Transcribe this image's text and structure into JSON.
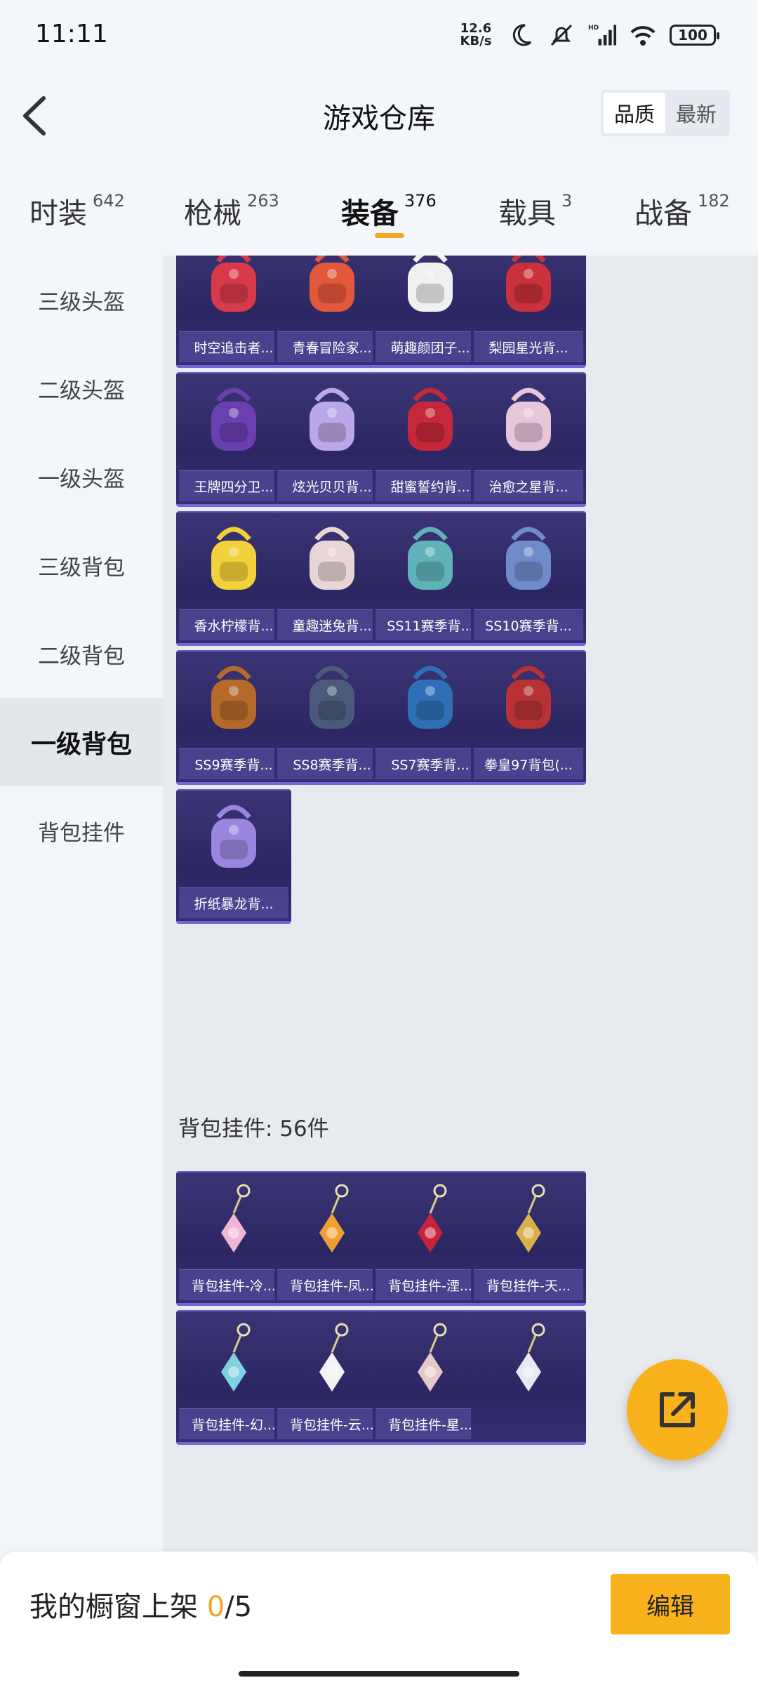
{
  "status": {
    "time": "11:11",
    "net_speed_value": "12.6",
    "net_speed_unit": "KB/s",
    "battery": "100",
    "icons": [
      "moon-icon",
      "mute-icon",
      "hd-signal-icon",
      "wifi-icon",
      "battery-icon"
    ]
  },
  "header": {
    "title": "游戏仓库",
    "sort_options": [
      "品质",
      "最新"
    ],
    "sort_selected": "品质"
  },
  "tabs": [
    {
      "name": "时装",
      "count": "642"
    },
    {
      "name": "枪械",
      "count": "263"
    },
    {
      "name": "装备",
      "count": "376"
    },
    {
      "name": "载具",
      "count": "3"
    },
    {
      "name": "战备",
      "count": "182"
    }
  ],
  "active_tab": "装备",
  "sidebar": {
    "items": [
      "三级头盔",
      "二级头盔",
      "一级头盔",
      "三级背包",
      "二级背包",
      "一级背包",
      "背包挂件"
    ],
    "active": "一级背包"
  },
  "backpacks": [
    "时空追击者...",
    "青春冒险家...",
    "萌趣颜团子...",
    "梨园星光背...",
    "王牌四分卫...",
    "炫光贝贝背...",
    "甜蜜誓约背...",
    "治愈之星背...",
    "香水柠檬背...",
    "童趣迷兔背...",
    "SS11赛季背...",
    "SS10赛季背...",
    "SS9赛季背...",
    "SS8赛季背...",
    "SS7赛季背...",
    "拳皇97背包(...",
    "折纸暴龙背..."
  ],
  "pendant_section": {
    "heading": "背包挂件: 56件",
    "items": [
      "背包挂件-冷...",
      "背包挂件-凤...",
      "背包挂件-湮...",
      "背包挂件-天...",
      "背包挂件-幻...",
      "背包挂件-云...",
      "背包挂件-星...",
      ""
    ]
  },
  "colors": {
    "accent": "#f9b21b",
    "card_bg": "#2c2763",
    "card_border": "#7366d6"
  },
  "bottom_bar": {
    "label": "我的橱窗上架 ",
    "count": "0",
    "total": "/5",
    "edit_label": "编辑"
  }
}
